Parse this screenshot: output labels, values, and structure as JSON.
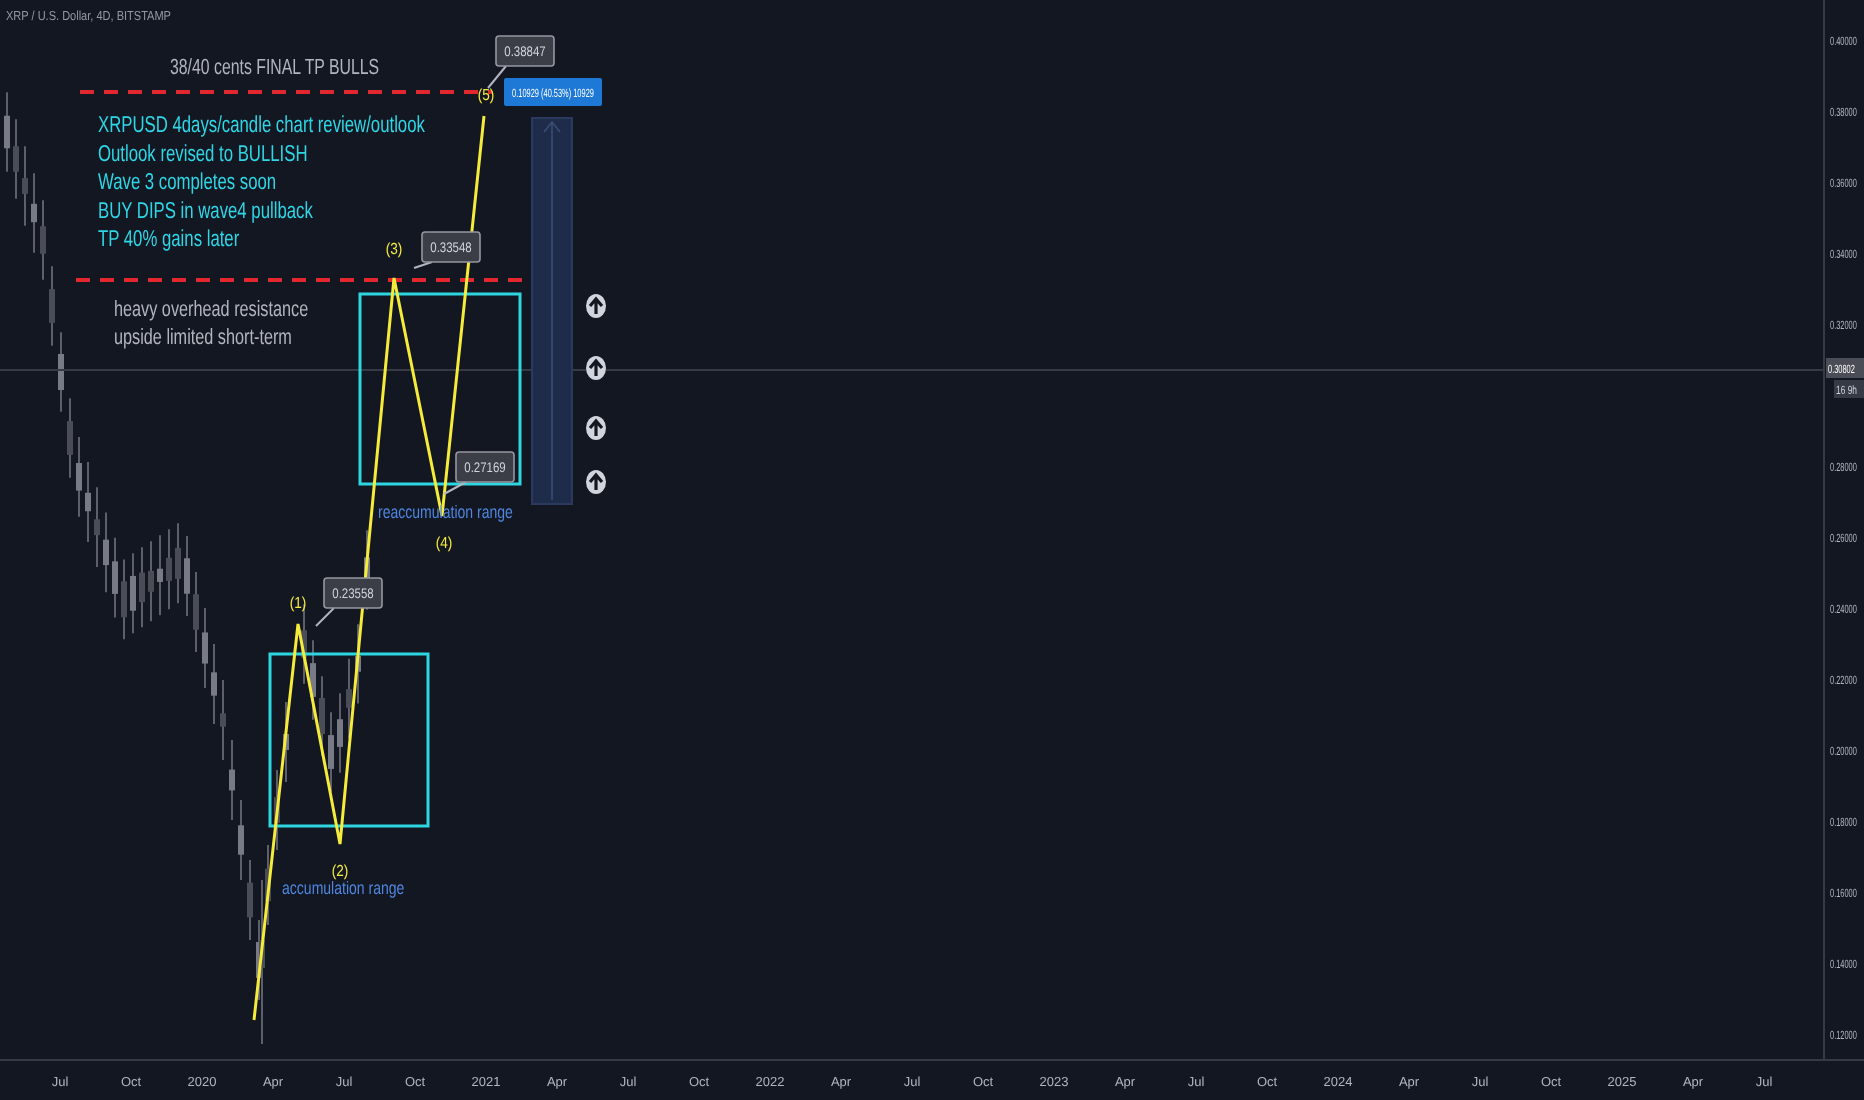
{
  "symbol": "XRP / U.S. Dollar, 4D, BITSTAMP",
  "price_axis": {
    "ticks": [
      "0.40000",
      "0.38000",
      "0.36000",
      "0.34000",
      "0.32000",
      "0.28000",
      "0.26000",
      "0.24000",
      "0.22000",
      "0.20000",
      "0.18000",
      "0.16000",
      "0.14000",
      "0.12000"
    ],
    "current_price": "0.30802",
    "countdown": "16 9h"
  },
  "time_axis": {
    "ticks": [
      "Jul",
      "Oct",
      "2020",
      "Apr",
      "Jul",
      "Oct",
      "2021",
      "Apr",
      "Jul",
      "Oct",
      "2022",
      "Apr",
      "Jul",
      "Oct",
      "2023",
      "Apr",
      "Jul",
      "Oct",
      "2024",
      "Apr",
      "Jul",
      "Oct",
      "2025",
      "Apr",
      "Jul"
    ]
  },
  "annotations": {
    "target_note": "38/40 cents FINAL TP BULLS",
    "outlook_lines": [
      "XRPUSD 4days/candle chart review/outlook",
      "Outlook revised to BULLISH",
      "Wave 3 completes soon",
      "BUY DIPS in wave4 pullback",
      "TP 40% gains later"
    ],
    "resistance_note": [
      "heavy overhead resistance",
      "upside limited short-term"
    ],
    "range_labels": [
      "reaccumulation range",
      "accumulation range"
    ],
    "wave_labels": [
      "(1)",
      "(2)",
      "(3)",
      "(4)",
      "(5)"
    ],
    "price_callouts": [
      "0.38847",
      "0.33548",
      "0.27169",
      "0.23558"
    ],
    "projection_label": "0.10929 (40.53%) 10929"
  }
}
